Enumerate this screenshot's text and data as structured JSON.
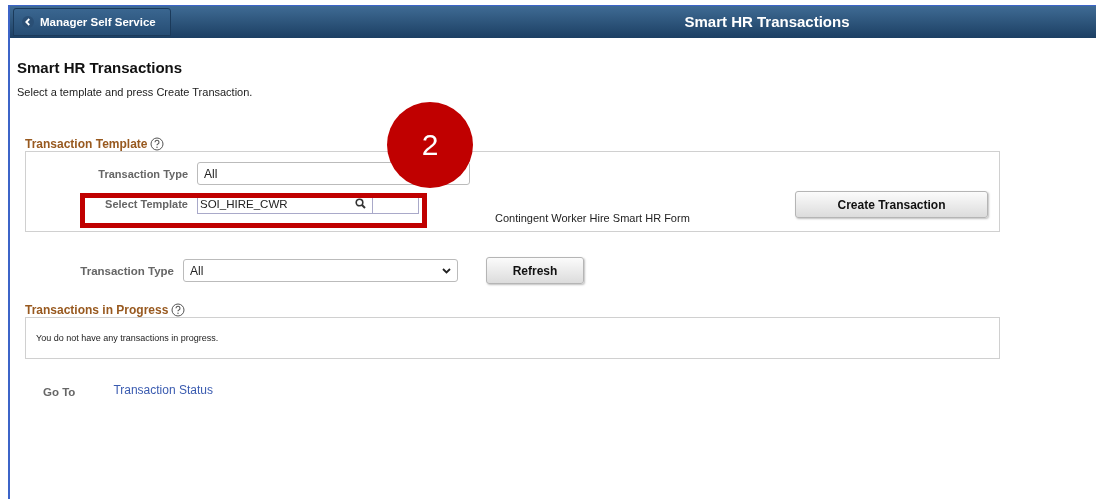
{
  "header": {
    "back_button": "Manager Self Service",
    "title": "Smart HR Transactions"
  },
  "page": {
    "title": "Smart HR Transactions",
    "instruction": "Select a template and press Create Transaction."
  },
  "transaction_template": {
    "heading": "Transaction Template",
    "transaction_type": {
      "label": "Transaction Type",
      "value": "All"
    },
    "select_template": {
      "label": "Select Template",
      "value": "SOI_HIRE_CWR"
    },
    "template_description": "Contingent Worker Hire Smart HR Form",
    "create_button": "Create Transaction"
  },
  "filter": {
    "label": "Transaction Type",
    "value": "All",
    "refresh_button": "Refresh"
  },
  "in_progress": {
    "heading": "Transactions in Progress",
    "message": "You do not have any transactions in progress."
  },
  "go_to": {
    "label": "Go To",
    "link": "Transaction Status"
  },
  "annotation": {
    "step": "2"
  }
}
